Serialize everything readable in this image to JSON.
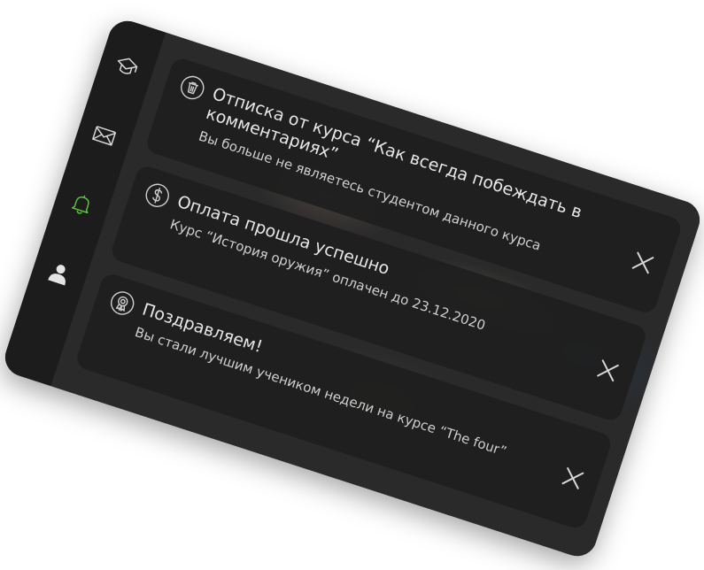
{
  "colors": {
    "panel_bg": "#1e1e1e",
    "card_bg": "#1e1e1e",
    "active_icon": "#56c43a",
    "text": "#e6e6e6"
  },
  "sidebar": {
    "items": [
      {
        "icon": "graduation-cap-icon",
        "active": false
      },
      {
        "icon": "mail-icon",
        "active": false
      },
      {
        "icon": "bell-icon",
        "active": true
      },
      {
        "icon": "user-icon",
        "active": false
      }
    ]
  },
  "notifications": [
    {
      "icon": "trash-icon",
      "title": "Отписка от курса “Как всегда побеждать в комментариях”",
      "text": "Вы больше не являетесь студентом данного курса"
    },
    {
      "icon": "dollar-icon",
      "title": "Оплата прошла успешно",
      "text": "Курс “История оружия” оплачен до 23.12.2020"
    },
    {
      "icon": "award-icon",
      "title": "Поздравляем!",
      "text": "Вы стали лучшим учеником недели на курсе “The four”"
    }
  ]
}
